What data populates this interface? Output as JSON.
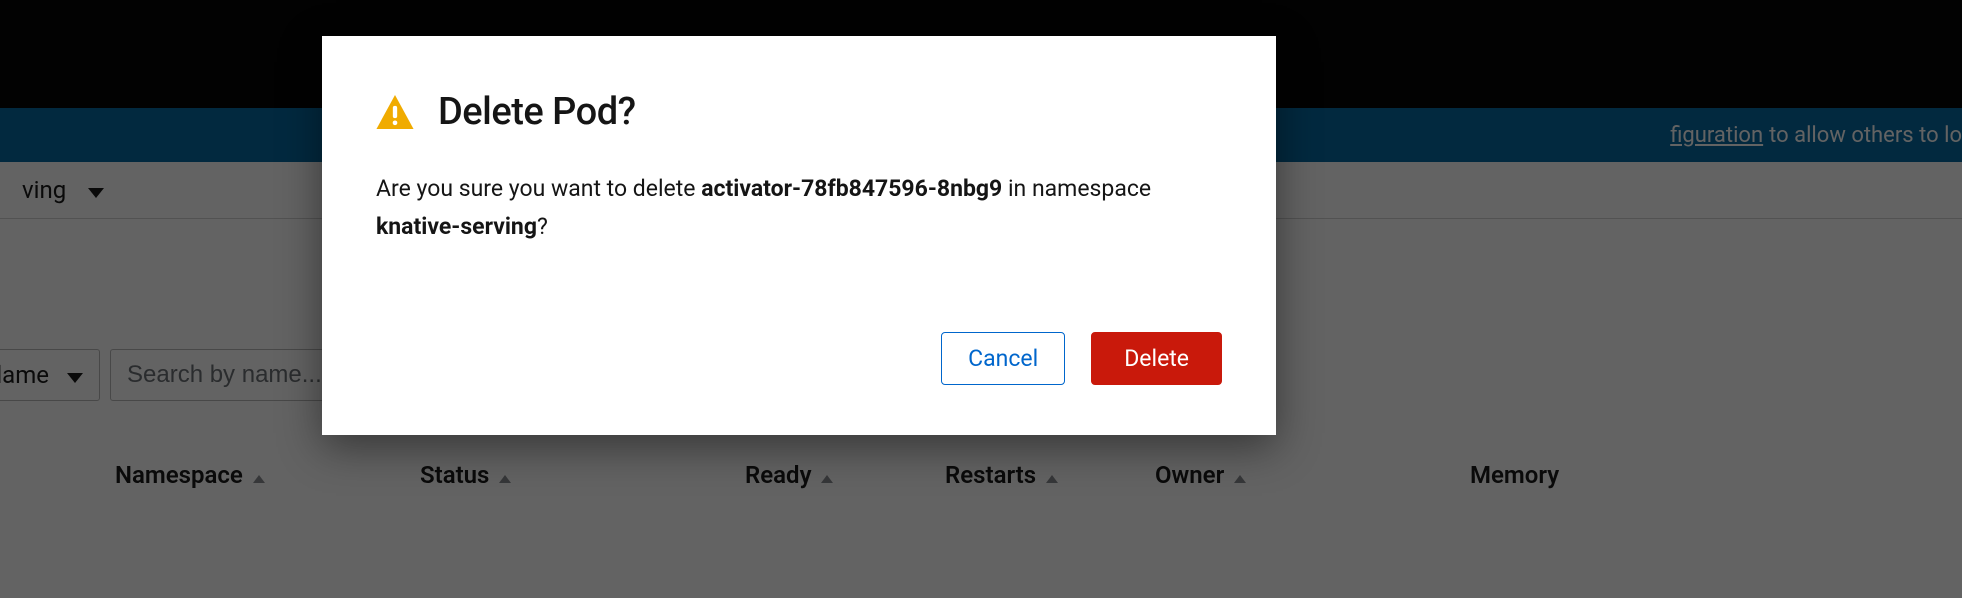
{
  "banner": {
    "link_text": "figuration",
    "rest_text": "to allow others to lo"
  },
  "project_dropdown": {
    "label": "ving"
  },
  "filter": {
    "dropdown_label": "lame",
    "search_placeholder": "Search by name..."
  },
  "table_headers": {
    "namespace": "Namespace",
    "status": "Status",
    "ready": "Ready",
    "restarts": "Restarts",
    "owner": "Owner",
    "memory": "Memory"
  },
  "modal": {
    "title": "Delete Pod?",
    "prompt_prefix": "Are you sure you want to delete ",
    "pod_name": "activator-78fb847596-8nbg9",
    "prompt_middle": " in namespace ",
    "namespace_name": "knative-serving",
    "prompt_suffix": "?",
    "cancel_label": "Cancel",
    "delete_label": "Delete"
  }
}
